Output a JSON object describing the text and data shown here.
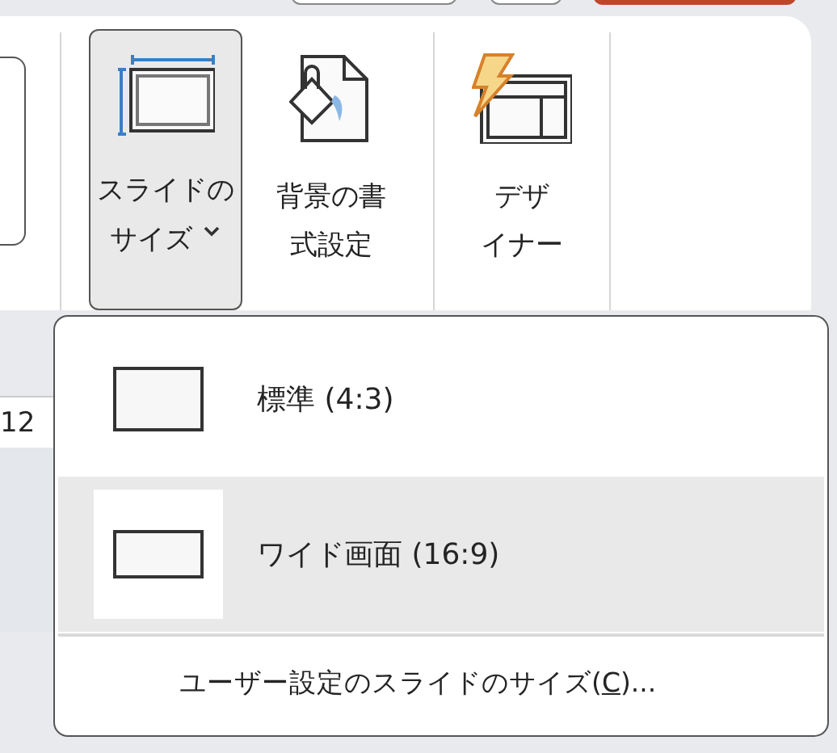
{
  "ribbon": {
    "buttons": [
      {
        "kind": "slide-size",
        "lines": [
          "スライドの",
          "サイズ"
        ],
        "dropdown": true,
        "selected": true
      },
      {
        "kind": "background",
        "lines": [
          "背景の書",
          "式設定"
        ],
        "dropdown": false,
        "selected": false
      },
      {
        "kind": "designer",
        "lines": [
          "デザ",
          "イナー"
        ],
        "dropdown": false,
        "selected": false
      }
    ]
  },
  "ruler": {
    "text": "12"
  },
  "menu": {
    "items": [
      {
        "kind": "standard",
        "label": "標準 (4:3)",
        "selected": false
      },
      {
        "kind": "wide",
        "label": "ワイド画面 (16:9)",
        "selected": true
      }
    ],
    "footer": {
      "before": "ユーザー設定のスライドのサイズ(",
      "access_key": "C",
      "after": ")..."
    }
  }
}
